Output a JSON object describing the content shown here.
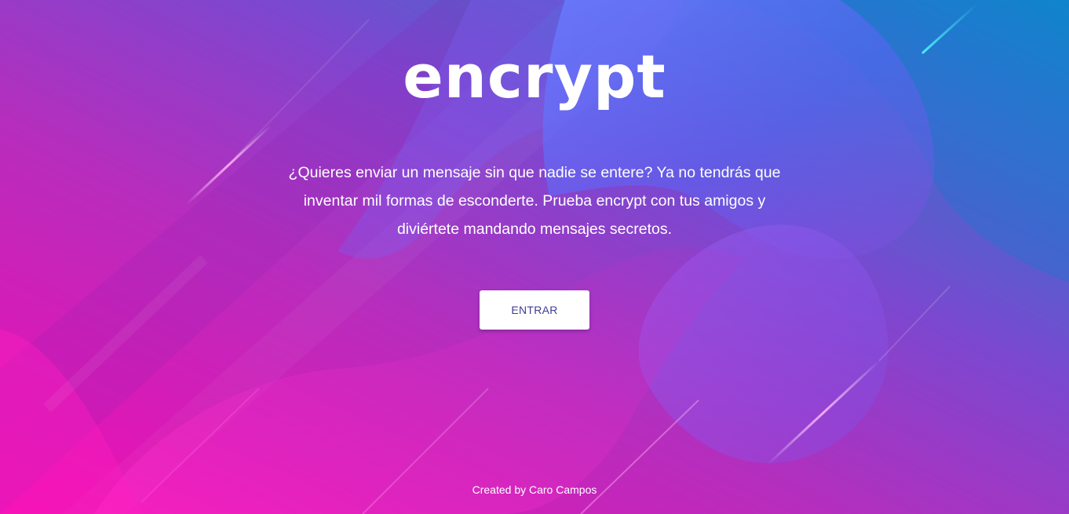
{
  "brand": {
    "logo_text": "encrypt"
  },
  "hero": {
    "description": "¿Quieres enviar un mensaje sin que nadie se entere? Ya no tendrás que inventar mil formas de esconderte. Prueba encrypt con tus amigos y diviértete mandando mensajes secretos.",
    "cta_label": "ENTRAR"
  },
  "footer": {
    "credit": "Created by Caro Campos"
  },
  "colors": {
    "background_pink": "#ee0fb3",
    "background_purple": "#9b35c8",
    "background_blue": "#0d8fd0",
    "button_background": "#ffffff",
    "button_text": "#3f3b94"
  }
}
